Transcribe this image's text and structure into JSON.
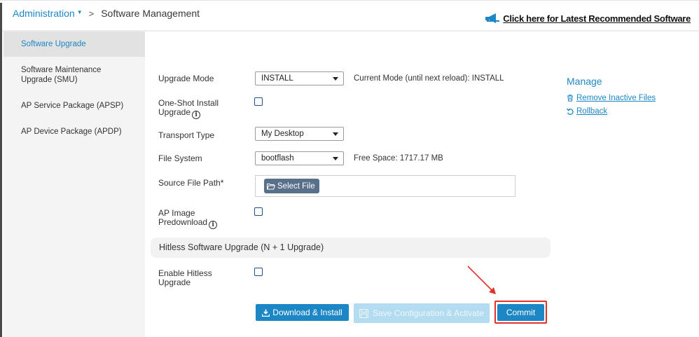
{
  "breadcrumb": {
    "parent": "Administration",
    "current": "Software Management"
  },
  "header": {
    "latest_link": "Click here for Latest Recommended Software"
  },
  "sidebar": {
    "items": [
      {
        "label": "Software Upgrade",
        "active": true
      },
      {
        "label": "Software Maintenance Upgrade (SMU)"
      },
      {
        "label": "AP Service Package (APSP)"
      },
      {
        "label": "AP Device Package (APDP)"
      }
    ]
  },
  "form": {
    "upgrade_mode_label": "Upgrade Mode",
    "upgrade_mode_value": "INSTALL",
    "current_mode_note": "Current Mode (until next reload): INSTALL",
    "one_shot_label_1": "One-Shot Install",
    "one_shot_label_2": "Upgrade",
    "transport_type_label": "Transport Type",
    "transport_type_value": "My Desktop",
    "file_system_label": "File System",
    "file_system_value": "bootflash",
    "free_space_note": "Free Space: 1717.17 MB",
    "source_file_label": "Source File Path*",
    "select_file_label": "Select File",
    "ap_image_label_1": "AP Image",
    "ap_image_label_2": "Predownload",
    "hitless_section_title": "Hitless Software Upgrade (N + 1 Upgrade)",
    "enable_hitless_label_1": "Enable Hitless",
    "enable_hitless_label_2": "Upgrade",
    "info_icon_char": "i"
  },
  "buttons": {
    "download_install": "Download & Install",
    "save_activate": "Save Configuration & Activate",
    "commit": "Commit"
  },
  "manage": {
    "title": "Manage",
    "remove_inactive": "Remove Inactive Files",
    "rollback": "Rollback"
  },
  "colors": {
    "accent": "#1d87c5",
    "disabled_button": "#b3dcf0",
    "highlight": "#e03228",
    "select_file_button": "#58708a"
  }
}
